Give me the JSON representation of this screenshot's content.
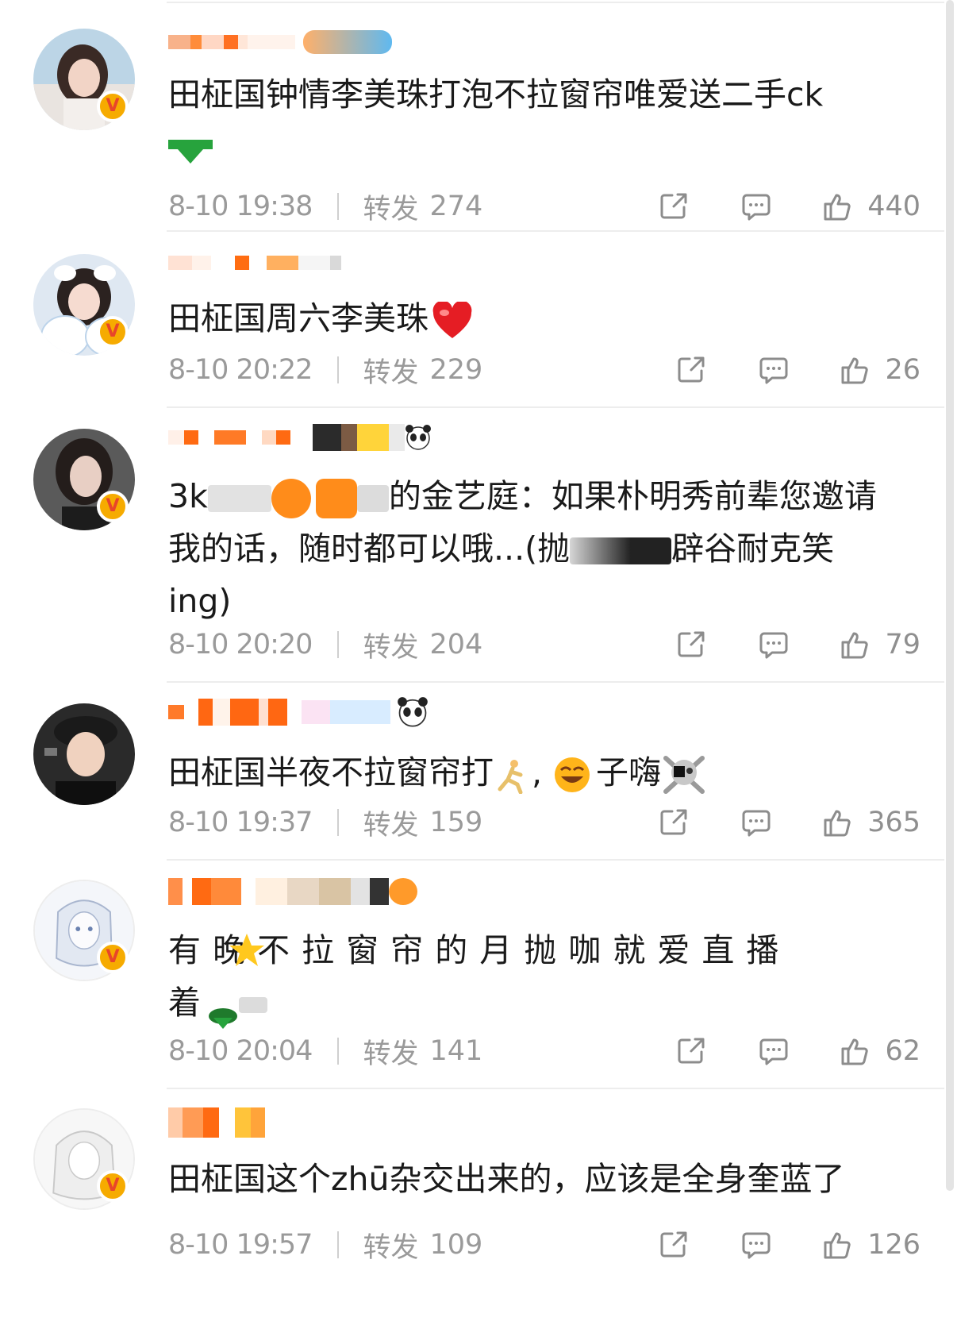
{
  "comments": [
    {
      "text_main": "田柾国钟情李美珠打泡不拉窗帘唯爱送二手ck",
      "time": "8-10 19:38",
      "repost_label": "转发",
      "repost_count": "274",
      "like_count": "440",
      "badge": "V"
    },
    {
      "text_main": "田柾国周六李美珠",
      "time": "8-10 20:22",
      "repost_label": "转发",
      "repost_count": "229",
      "like_count": "26",
      "badge": "V"
    },
    {
      "text_part1": "3k",
      "text_part2": "的金艺庭：如果朴明秀前辈您邀请",
      "text_line2a": "我的话，随时都可以哦...(抛",
      "text_line2b": "辟谷耐克笑",
      "text_line3": "ing)",
      "time": "8-10 20:20",
      "repost_label": "转发",
      "repost_count": "204",
      "like_count": "79",
      "badge": "V"
    },
    {
      "text_main": "田柾国半夜不拉窗帘打",
      "text_tail": "子嗨",
      "time": "8-10 19:37",
      "repost_label": "转发",
      "repost_count": "159",
      "like_count": "365"
    },
    {
      "text_line1": "有  晚 不 拉 窗 帘 的 月 抛 咖 就 爱 直 播",
      "text_line2": "着",
      "time": "8-10 20:04",
      "repost_label": "转发",
      "repost_count": "141",
      "like_count": "62",
      "badge": "V"
    },
    {
      "text_main": "田柾国这个zhū杂交出来的，应该是全身奎蓝了",
      "time": "8-10 19:57",
      "repost_label": "转发",
      "repost_count": "109",
      "like_count": "126",
      "badge": "V"
    }
  ],
  "colors": {
    "meta_gray": "#9a9a9a",
    "badge_yellow": "#f6ab00",
    "badge_v": "#e8452a",
    "divider": "#ededed"
  },
  "icons": [
    "share-icon",
    "comment-icon",
    "like-icon",
    "heart-emoji",
    "green-arrow-emoji",
    "panda-emoji",
    "star-emoji",
    "skull-emoji"
  ]
}
